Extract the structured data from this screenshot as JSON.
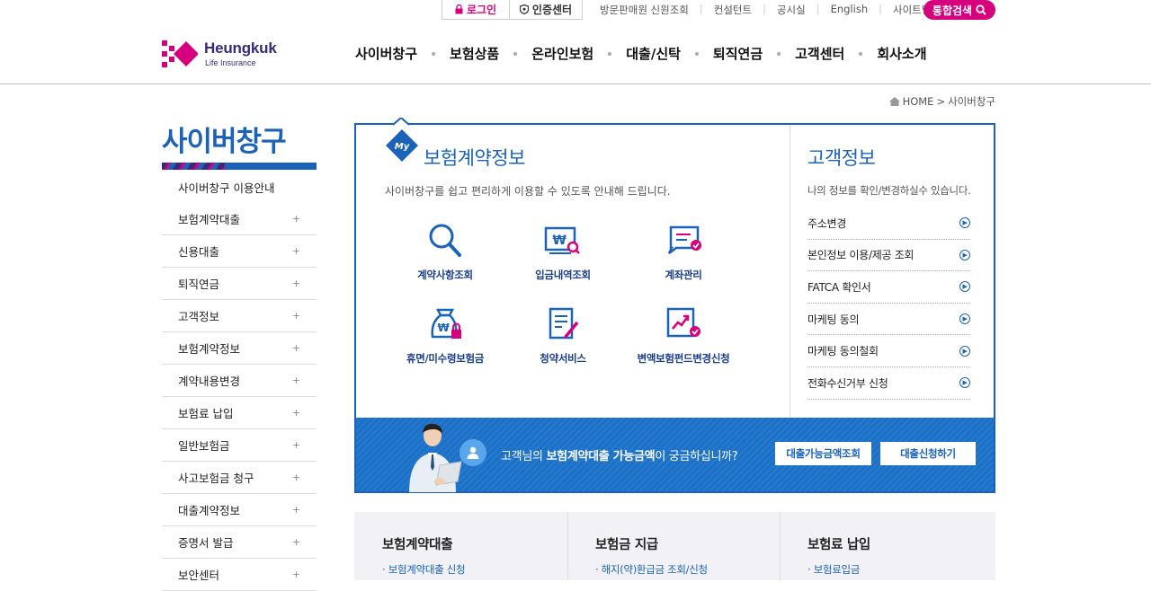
{
  "topbar": {
    "login_label": "로그인",
    "cert_label": "인증센터",
    "links": [
      "방문판매원 신원조회",
      "컨설턴트",
      "공시실",
      "English",
      "사이트맵"
    ],
    "search_label": "통합검색"
  },
  "brand": {
    "name": "Heungkuk",
    "subtitle": "Life Insurance",
    "color_primary": "#1a63b8",
    "color_accent": "#d6007f"
  },
  "gnb": [
    "사이버창구",
    "보험상품",
    "온라인보험",
    "대출/신탁",
    "퇴직연금",
    "고객센터",
    "회사소개"
  ],
  "breadcrumb": {
    "home": "HOME",
    "sep": ">",
    "current": "사이버창구"
  },
  "sidebar": {
    "title": "사이버창구",
    "items": [
      {
        "label": "사이버창구 이용안내",
        "plus": ""
      },
      {
        "label": "보험계약대출",
        "plus": "+"
      },
      {
        "label": "신용대출",
        "plus": "+"
      },
      {
        "label": "퇴직연금",
        "plus": "+"
      },
      {
        "label": "고객정보",
        "plus": "+"
      },
      {
        "label": "보험계약정보",
        "plus": "+"
      },
      {
        "label": "계약내용변경",
        "plus": "+"
      },
      {
        "label": "보험료 납입",
        "plus": "+"
      },
      {
        "label": "일반보험금",
        "plus": "+"
      },
      {
        "label": "사고보험금 청구",
        "plus": "+"
      },
      {
        "label": "대출계약정보",
        "plus": "+"
      },
      {
        "label": "증명서 발급",
        "plus": "+"
      },
      {
        "label": "보안센터",
        "plus": "+"
      }
    ]
  },
  "contract": {
    "badge": "My",
    "title": "보험계약정보",
    "desc": "사이버창구를 쉽고 편리하게 이용할 수 있도록 안내해 드립니다.",
    "services": [
      {
        "label": "계약사항조회",
        "icon": "magnifier-icon"
      },
      {
        "label": "입금내역조회",
        "icon": "deposit-search-icon"
      },
      {
        "label": "계좌관리",
        "icon": "account-manage-icon"
      },
      {
        "label": "휴면/미수령보험금",
        "icon": "dormant-money-icon"
      },
      {
        "label": "청약서비스",
        "icon": "application-doc-icon"
      },
      {
        "label": "변액보험펀드변경신청",
        "icon": "fund-change-icon"
      }
    ]
  },
  "customer": {
    "title": "고객정보",
    "desc": "나의 정보를 확인/변경하실수 있습니다.",
    "items": [
      "주소변경",
      "본인정보 이용/제공 조회",
      "FATCA 확인서",
      "마케팅 동의",
      "마케팅 동의철회",
      "전화수신거부 신청"
    ]
  },
  "banner": {
    "text_pre": "고객님의 ",
    "text_bold": "보험계약대출 가능금액",
    "text_post": "이 궁금하십니까?",
    "btn1": "대출가능금액조회",
    "btn2": "대출신청하기"
  },
  "bottom": [
    {
      "title": "보험계약대출",
      "link": "보험계약대출 신청"
    },
    {
      "title": "보험금 지급",
      "link": "해지(약)환급금 조회/신청"
    },
    {
      "title": "보험료 납입",
      "link": "보험료입금"
    }
  ]
}
